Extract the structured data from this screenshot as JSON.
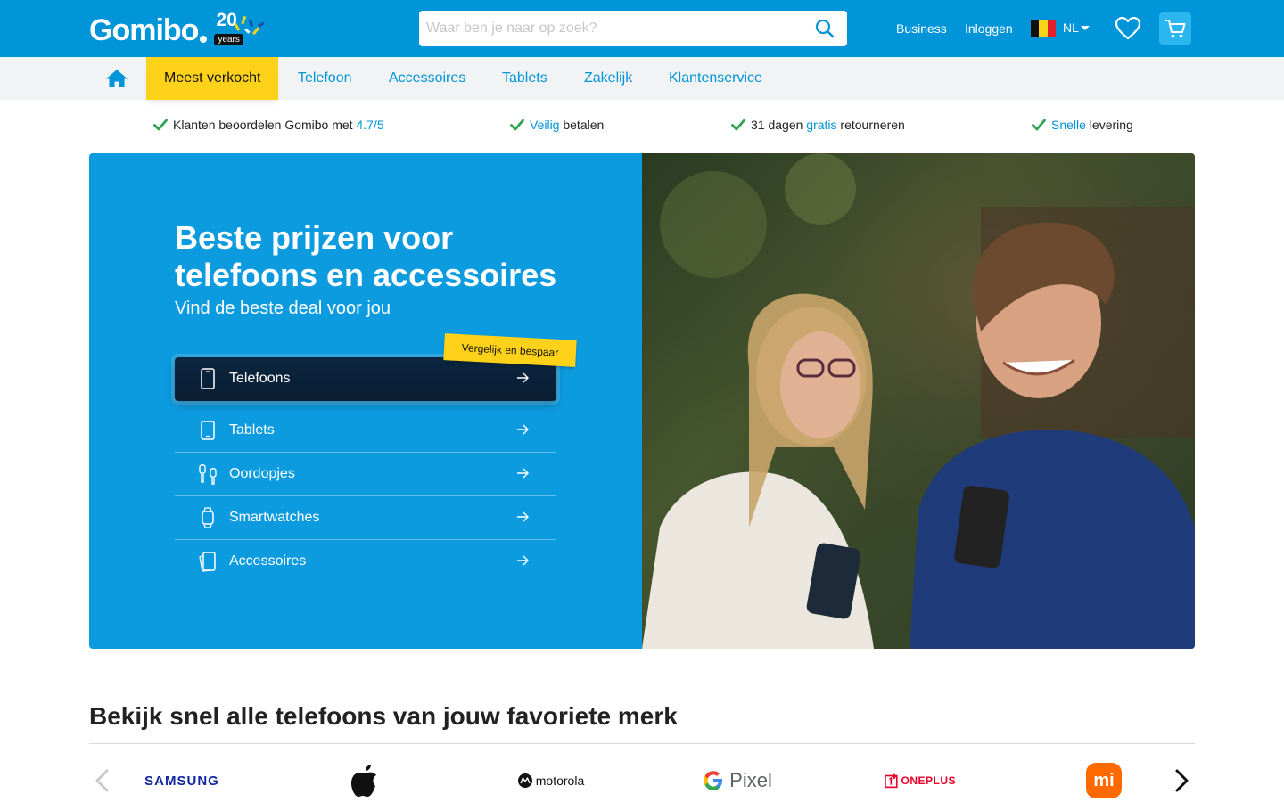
{
  "header": {
    "logo_text": "Gomibo",
    "logo_badge_number": "20",
    "logo_badge_text": "years",
    "search_placeholder": "Waar ben je naar op zoek?",
    "business_label": "Business",
    "login_label": "Inloggen",
    "language": "NL",
    "flag_colors": [
      "#111111",
      "#f7d417",
      "#e2202c"
    ],
    "accent_color": "#0094d9"
  },
  "nav": {
    "home_icon": "home-icon",
    "tabs": [
      {
        "label": "Meest verkocht",
        "active": true
      },
      {
        "label": "Telefoon"
      },
      {
        "label": "Accessoires"
      },
      {
        "label": "Tablets"
      },
      {
        "label": "Zakelijk"
      },
      {
        "label": "Klantenservice"
      }
    ]
  },
  "usps": [
    {
      "pre": "Klanten beoordelen Gomibo met ",
      "highlight": "4.7/5",
      "post": ""
    },
    {
      "pre": "",
      "highlight": "Veilig",
      "post": " betalen"
    },
    {
      "pre": "31 dagen ",
      "highlight": "gratis",
      "post": " retourneren"
    },
    {
      "pre": "",
      "highlight": "Snelle",
      "post": " levering"
    }
  ],
  "hero": {
    "title": "Beste prijzen voor telefoons en accessoires",
    "subtitle": "Vind de beste deal voor jou",
    "sticker": "Vergelijk en bespaar",
    "categories": [
      {
        "label": "Telefoons",
        "icon": "phone-icon"
      },
      {
        "label": "Tablets",
        "icon": "tablet-icon"
      },
      {
        "label": "Oordopjes",
        "icon": "earbuds-icon"
      },
      {
        "label": "Smartwatches",
        "icon": "smartwatch-icon"
      },
      {
        "label": "Accessoires",
        "icon": "phone-case-icon"
      }
    ]
  },
  "brands": {
    "title": "Bekijk snel alle telefoons van jouw favoriete merk",
    "items": [
      "SAMSUNG",
      "Apple",
      "motorola",
      "Pixel",
      "ONEPLUS",
      "mi"
    ]
  }
}
